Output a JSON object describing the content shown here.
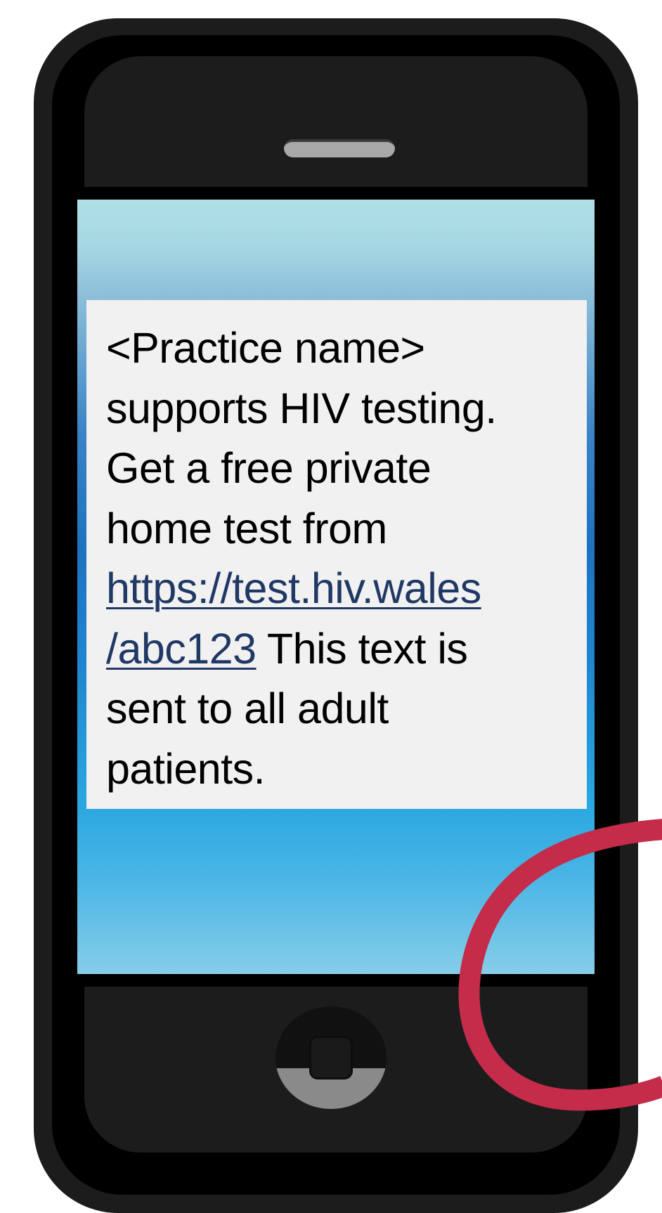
{
  "message": {
    "line1": "<Practice name>",
    "line2": "supports HIV testing.",
    "line3": "Get a free private",
    "line4": "home test from",
    "link_line1": "https://test.hiv.wales",
    "link_line2": "/abc123",
    "after_link": " This text is",
    "line7": "sent to all adult",
    "line8": "patients."
  },
  "colors": {
    "phone_body": "#1c1c1c",
    "screen_top": "#b0e0e6",
    "screen_mid": "#1e72c0",
    "card_background": "#f1f1f2",
    "link": "#203864",
    "swirl": "#c42c4a"
  },
  "icons": {
    "speaker": "speaker-grille-icon",
    "home": "home-button-icon",
    "decoration": "red-swirl"
  }
}
